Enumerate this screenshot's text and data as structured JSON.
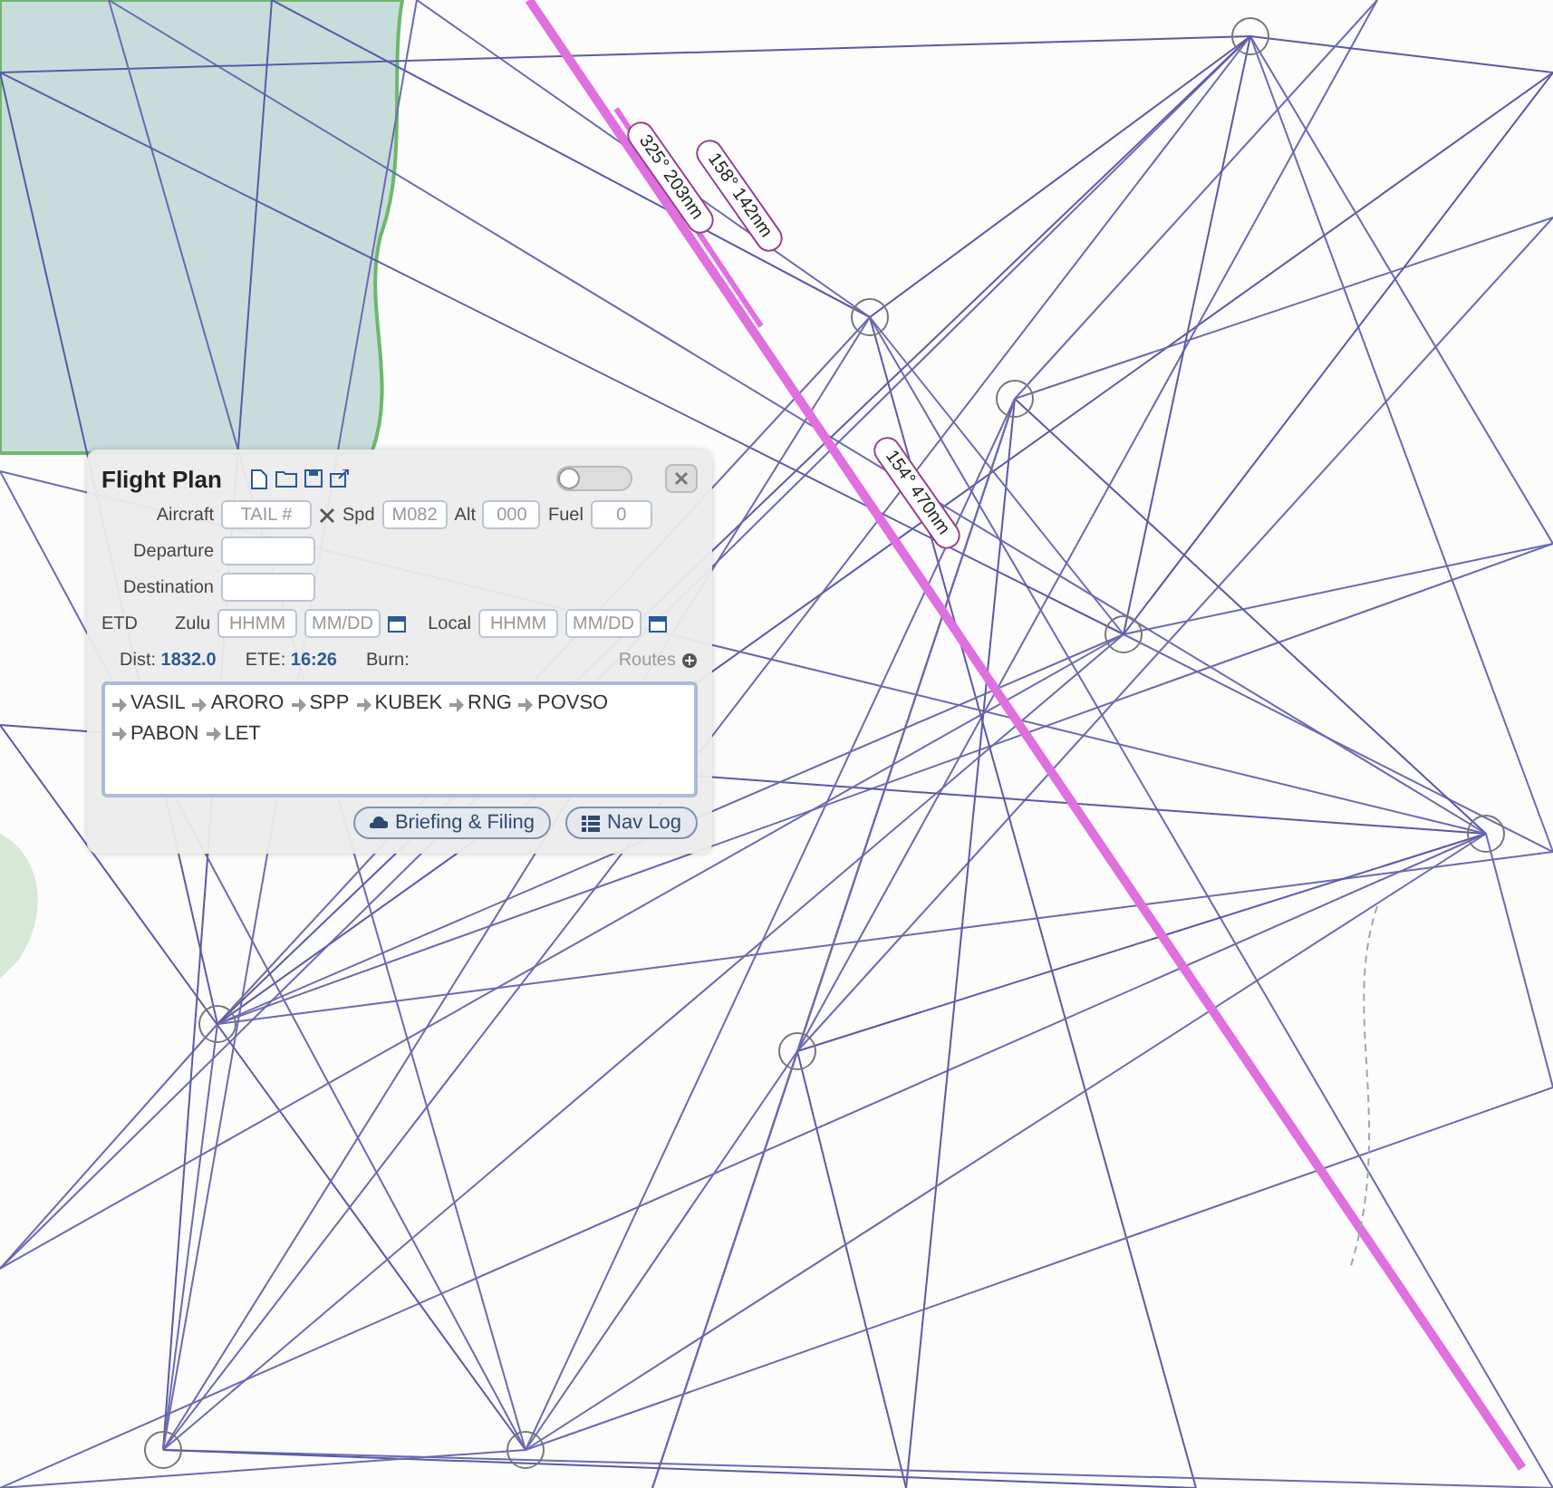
{
  "map": {
    "leg_labels": [
      {
        "text": "325° 203nm"
      },
      {
        "text": "158° 142nm"
      },
      {
        "text": "154° 470nm"
      }
    ]
  },
  "flight_plan": {
    "title": "Flight Plan",
    "toggle": {
      "on": false
    },
    "aircraft": {
      "label": "Aircraft",
      "placeholder": "TAIL #"
    },
    "speed": {
      "label": "Spd",
      "placeholder": "M082"
    },
    "altitude": {
      "label": "Alt",
      "placeholder": "000"
    },
    "fuel": {
      "label": "Fuel",
      "placeholder": "0"
    },
    "departure": {
      "label": "Departure"
    },
    "destination": {
      "label": "Destination"
    },
    "etd": {
      "label": "ETD",
      "zulu_label": "Zulu",
      "zulu_time_placeholder": "HHMM",
      "zulu_date_placeholder": "MM/DD",
      "local_label": "Local",
      "local_time_placeholder": "HHMM",
      "local_date_placeholder": "MM/DD"
    },
    "stats": {
      "dist_label": "Dist:",
      "dist": "1832.0",
      "ete_label": "ETE:",
      "ete": "16:26",
      "burn_label": "Burn:",
      "routes": "Routes"
    },
    "route": [
      "VASIL",
      "ARORO",
      "SPP",
      "KUBEK",
      "RNG",
      "POVSO",
      "PABON",
      "LET"
    ],
    "buttons": [
      {
        "kind": "briefing",
        "label": "Briefing & Filing"
      },
      {
        "kind": "navlog",
        "label": "Nav Log"
      }
    ]
  }
}
